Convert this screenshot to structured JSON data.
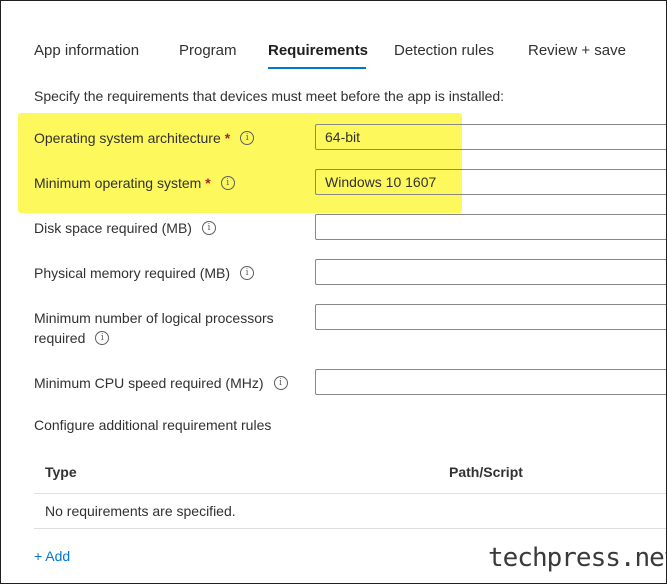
{
  "tabs": [
    {
      "label": "App information"
    },
    {
      "label": "Program"
    },
    {
      "label": "Requirements"
    },
    {
      "label": "Detection rules"
    },
    {
      "label": "Review + save"
    }
  ],
  "description": "Specify the requirements that devices must meet before the app is installed:",
  "fields": {
    "os_architecture": {
      "label": "Operating system architecture",
      "required": "*",
      "value": "64-bit"
    },
    "min_os": {
      "label": "Minimum operating system",
      "required": "*",
      "value": "Windows 10 1607"
    },
    "disk_space": {
      "label": "Disk space required (MB)",
      "value": ""
    },
    "physical_memory": {
      "label": "Physical memory required (MB)",
      "value": ""
    },
    "logical_processors": {
      "label_line1": "Minimum number of logical processors",
      "label_line2": "required",
      "value": ""
    },
    "cpu_speed": {
      "label": "Minimum CPU speed required (MHz)",
      "value": ""
    }
  },
  "info_glyph": "i",
  "additional_rules": {
    "label": "Configure additional requirement rules",
    "columns": [
      "Type",
      "Path/Script"
    ],
    "empty_text": "No requirements are specified.",
    "add_label": "+ Add"
  },
  "watermark": "techpress.net",
  "colors": {
    "accent": "#0078d4",
    "highlight": "#fdf95c",
    "required": "#a4262c"
  }
}
